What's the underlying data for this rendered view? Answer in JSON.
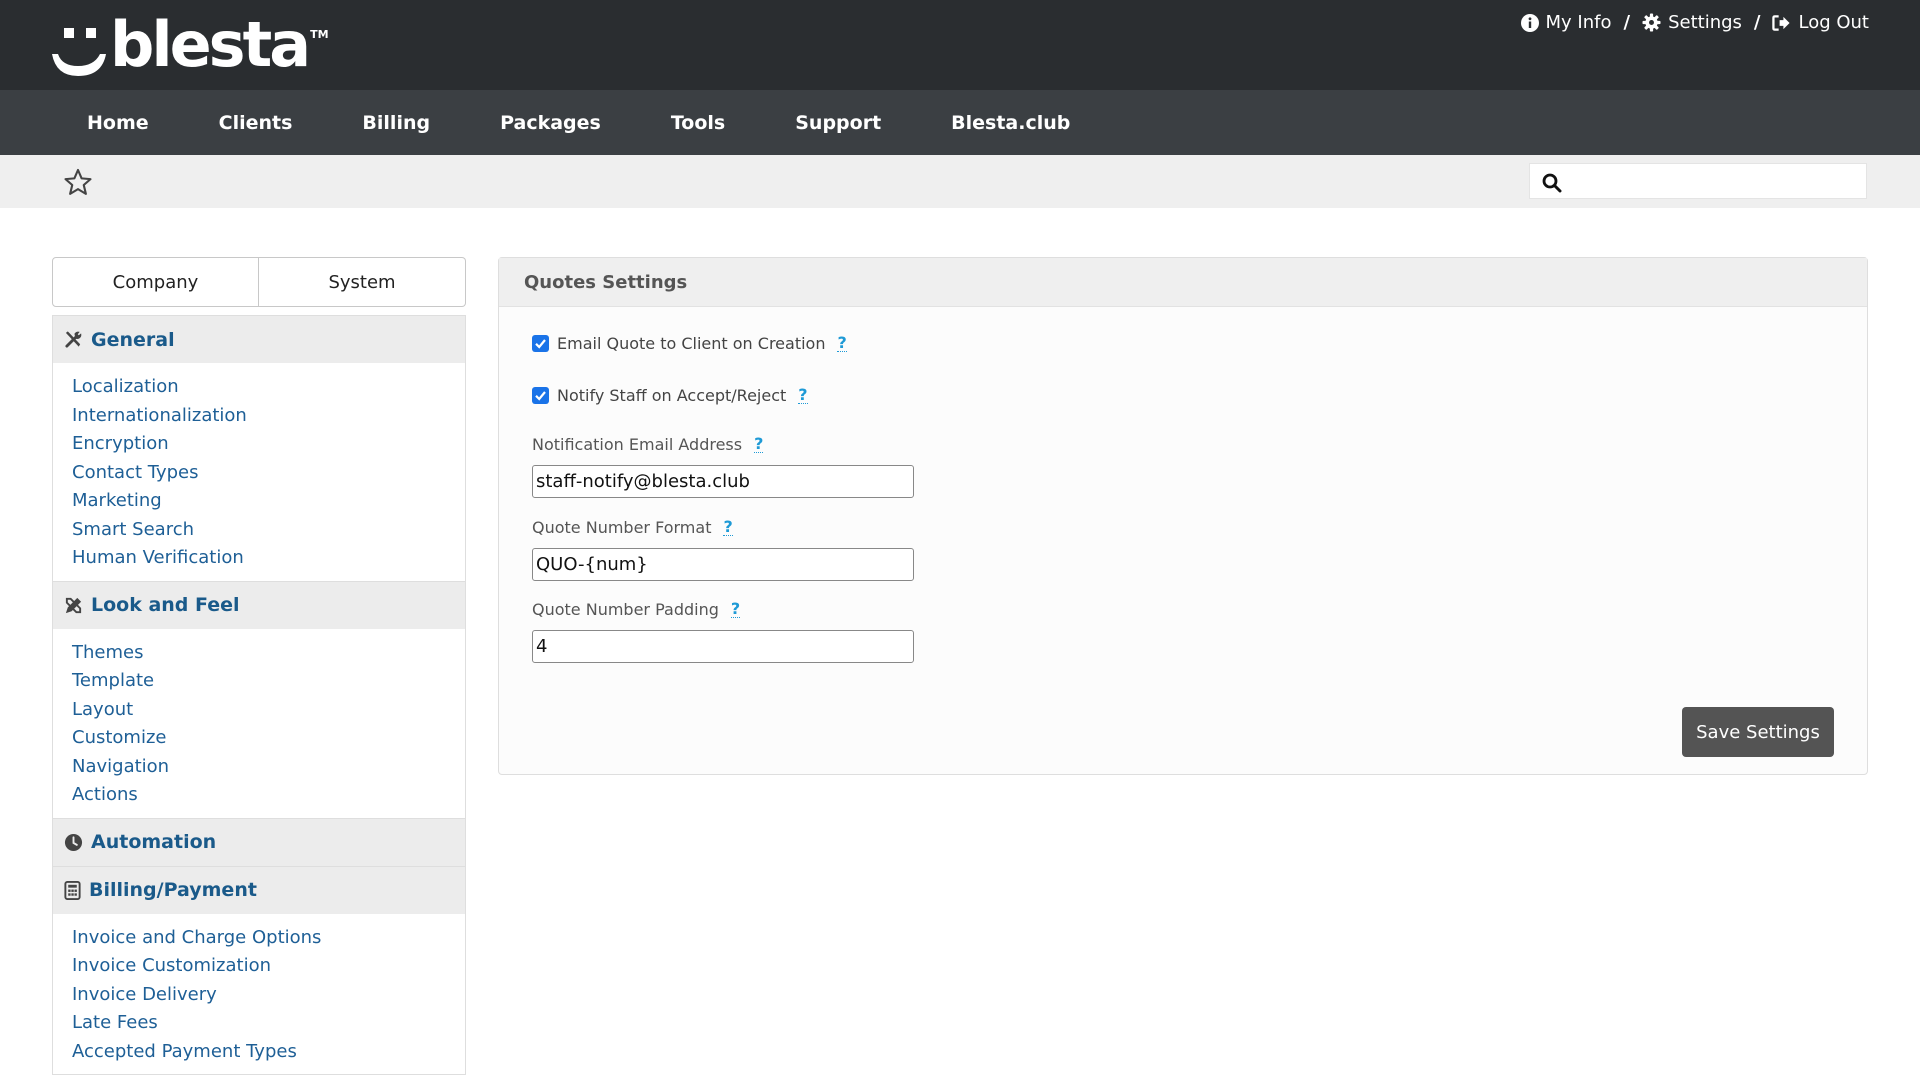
{
  "brand": {
    "name": "blesta",
    "tm": "TM"
  },
  "toplinks": {
    "my_info": "My Info",
    "settings": "Settings",
    "logout": "Log Out",
    "separator": "/"
  },
  "nav": [
    "Home",
    "Clients",
    "Billing",
    "Packages",
    "Tools",
    "Support",
    "Blesta.club"
  ],
  "search": {
    "value": ""
  },
  "tabs": {
    "company": "Company",
    "system": "System"
  },
  "sidebar": {
    "general": {
      "title": "General",
      "items": [
        "Localization",
        "Internationalization",
        "Encryption",
        "Contact Types",
        "Marketing",
        "Smart Search",
        "Human Verification"
      ]
    },
    "look": {
      "title": "Look and Feel",
      "items": [
        "Themes",
        "Template",
        "Layout",
        "Customize",
        "Navigation",
        "Actions"
      ]
    },
    "automation": {
      "title": "Automation"
    },
    "billing": {
      "title": "Billing/Payment",
      "items": [
        "Invoice and Charge Options",
        "Invoice Customization",
        "Invoice Delivery",
        "Late Fees",
        "Accepted Payment Types"
      ]
    }
  },
  "panel": {
    "title": "Quotes Settings",
    "email_quote_label": "Email Quote to Client on Creation",
    "email_quote_checked": true,
    "notify_staff_label": "Notify Staff on Accept/Reject",
    "notify_staff_checked": true,
    "help_glyph": "?",
    "notify_email": {
      "label": "Notification Email Address",
      "value": "staff-notify@blesta.club"
    },
    "number_format": {
      "label": "Quote Number Format",
      "value": "QUO-{num}"
    },
    "number_padding": {
      "label": "Quote Number Padding",
      "value": "4"
    },
    "save_label": "Save Settings"
  },
  "colors": {
    "topbar": "#2a2d30",
    "navbar": "#3b3f43",
    "link": "#1e5f96",
    "help": "#1e9ad6",
    "button": "#545454"
  }
}
